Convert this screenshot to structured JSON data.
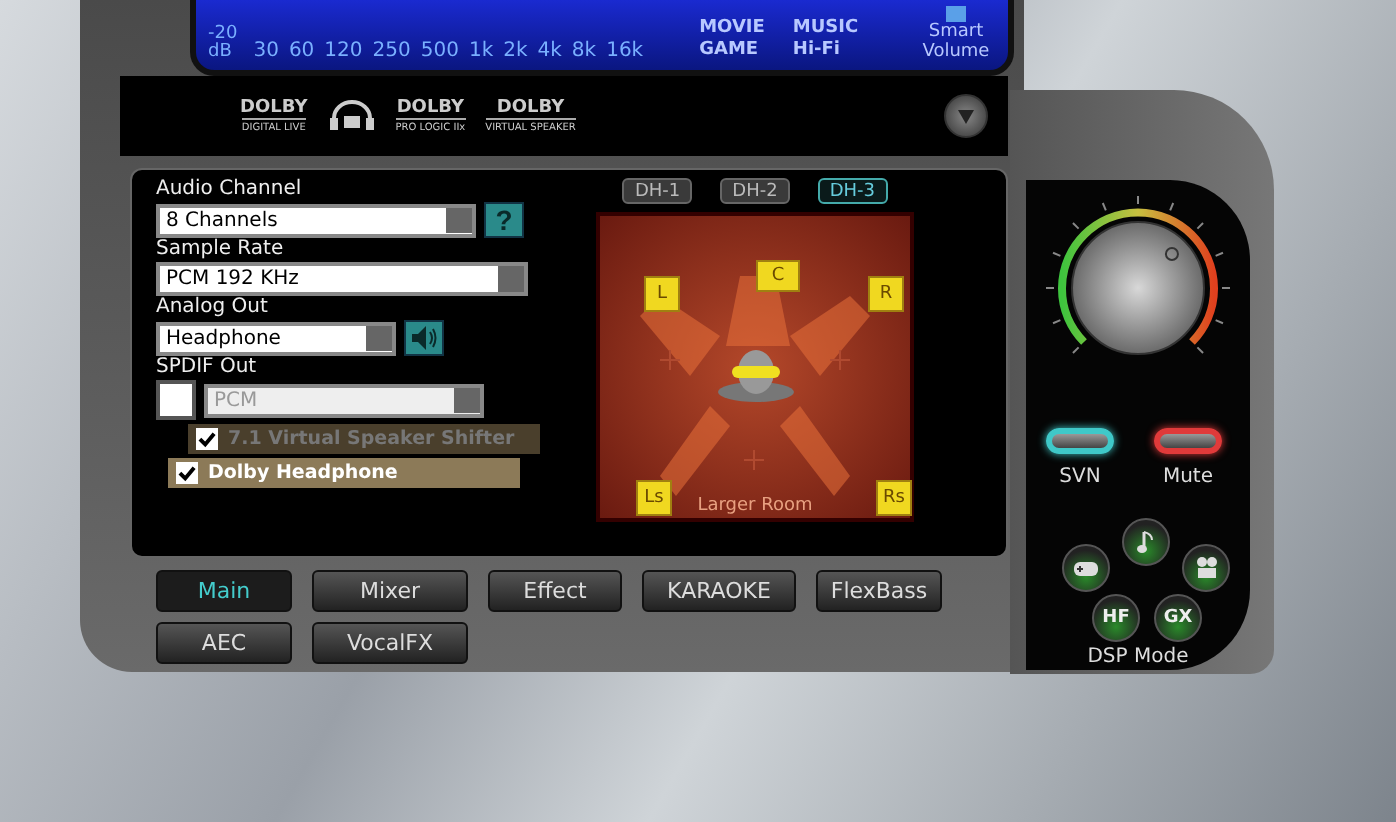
{
  "display": {
    "db_value": "-20",
    "db_unit": "dB",
    "frequencies": [
      "30",
      "60",
      "120",
      "250",
      "500",
      "1k",
      "2k",
      "4k",
      "8k",
      "16k"
    ],
    "modes": [
      "MOVIE",
      "MUSIC",
      "GAME",
      "Hi-Fi"
    ],
    "smart_volume": "Smart Volume"
  },
  "logos": [
    {
      "kind": "dolby",
      "text": "DOLBY",
      "caption": "DIGITAL LIVE"
    },
    {
      "kind": "headphone"
    },
    {
      "kind": "dolby",
      "text": "DOLBY",
      "caption": "PRO LOGIC IIx"
    },
    {
      "kind": "dolby",
      "text": "DOLBY",
      "caption": "VIRTUAL SPEAKER"
    }
  ],
  "audio_channel": {
    "label": "Audio Channel",
    "value": "8 Channels",
    "help": "?"
  },
  "sample_rate": {
    "label": "Sample Rate",
    "value": "PCM 192 KHz"
  },
  "analog_out": {
    "label": "Analog Out",
    "value": "Headphone"
  },
  "spdif_out": {
    "label": "SPDIF Out",
    "checked": false,
    "value": "PCM",
    "disabled": true
  },
  "options": [
    {
      "label": "7.1 Virtual Speaker Shifter",
      "checked": true,
      "disabled": true
    },
    {
      "label": "Dolby Headphone",
      "checked": true,
      "disabled": false
    }
  ],
  "dh_modes": [
    {
      "label": "DH-1",
      "selected": false
    },
    {
      "label": "DH-2",
      "selected": false
    },
    {
      "label": "DH-3",
      "selected": true
    }
  ],
  "room": {
    "speakers": [
      {
        "label": "L"
      },
      {
        "label": "C"
      },
      {
        "label": "R"
      },
      {
        "label": "Ls"
      },
      {
        "label": "Rs"
      }
    ],
    "caption": "Larger Room"
  },
  "toggles": [
    {
      "label": "SVN",
      "color": "#3fc8c8"
    },
    {
      "label": "Mute",
      "color": "#e03a3a"
    }
  ],
  "dsp_mode": {
    "label": "DSP Mode",
    "buttons": [
      {
        "kind": "game"
      },
      {
        "kind": "music"
      },
      {
        "kind": "movie"
      },
      {
        "kind": "text",
        "text": "HF"
      },
      {
        "kind": "text",
        "text": "GX"
      }
    ]
  },
  "tabs": [
    {
      "label": "Main",
      "selected": true
    },
    {
      "label": "Mixer",
      "selected": false
    },
    {
      "label": "Effect",
      "selected": false
    },
    {
      "label": "KARAOKE",
      "selected": false
    },
    {
      "label": "FlexBass",
      "selected": false
    },
    {
      "label": "AEC",
      "selected": false
    },
    {
      "label": "VocalFX",
      "selected": false
    }
  ]
}
